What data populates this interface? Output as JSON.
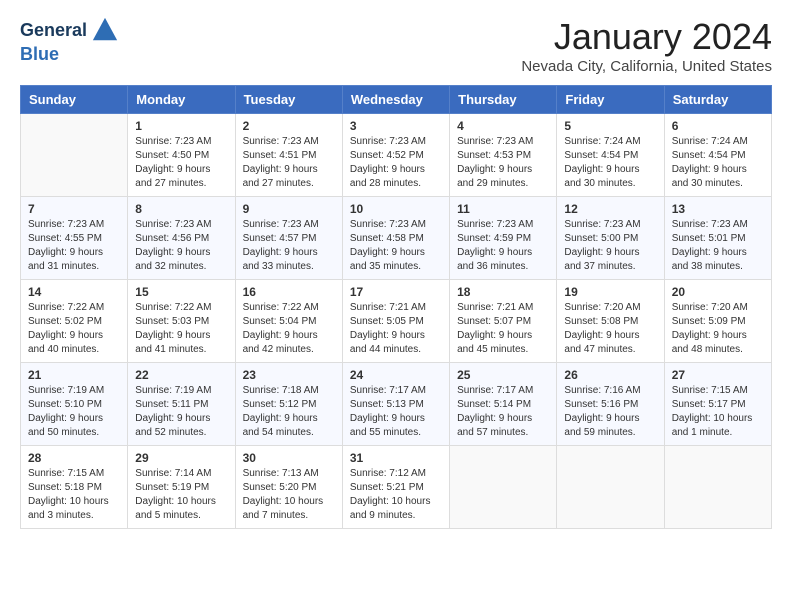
{
  "header": {
    "logo_general": "General",
    "logo_blue": "Blue",
    "month_title": "January 2024",
    "location": "Nevada City, California, United States"
  },
  "calendar": {
    "days_of_week": [
      "Sunday",
      "Monday",
      "Tuesday",
      "Wednesday",
      "Thursday",
      "Friday",
      "Saturday"
    ],
    "weeks": [
      [
        {
          "day": "",
          "info": ""
        },
        {
          "day": "1",
          "info": "Sunrise: 7:23 AM\nSunset: 4:50 PM\nDaylight: 9 hours\nand 27 minutes."
        },
        {
          "day": "2",
          "info": "Sunrise: 7:23 AM\nSunset: 4:51 PM\nDaylight: 9 hours\nand 27 minutes."
        },
        {
          "day": "3",
          "info": "Sunrise: 7:23 AM\nSunset: 4:52 PM\nDaylight: 9 hours\nand 28 minutes."
        },
        {
          "day": "4",
          "info": "Sunrise: 7:23 AM\nSunset: 4:53 PM\nDaylight: 9 hours\nand 29 minutes."
        },
        {
          "day": "5",
          "info": "Sunrise: 7:24 AM\nSunset: 4:54 PM\nDaylight: 9 hours\nand 30 minutes."
        },
        {
          "day": "6",
          "info": "Sunrise: 7:24 AM\nSunset: 4:54 PM\nDaylight: 9 hours\nand 30 minutes."
        }
      ],
      [
        {
          "day": "7",
          "info": "Sunrise: 7:23 AM\nSunset: 4:55 PM\nDaylight: 9 hours\nand 31 minutes."
        },
        {
          "day": "8",
          "info": "Sunrise: 7:23 AM\nSunset: 4:56 PM\nDaylight: 9 hours\nand 32 minutes."
        },
        {
          "day": "9",
          "info": "Sunrise: 7:23 AM\nSunset: 4:57 PM\nDaylight: 9 hours\nand 33 minutes."
        },
        {
          "day": "10",
          "info": "Sunrise: 7:23 AM\nSunset: 4:58 PM\nDaylight: 9 hours\nand 35 minutes."
        },
        {
          "day": "11",
          "info": "Sunrise: 7:23 AM\nSunset: 4:59 PM\nDaylight: 9 hours\nand 36 minutes."
        },
        {
          "day": "12",
          "info": "Sunrise: 7:23 AM\nSunset: 5:00 PM\nDaylight: 9 hours\nand 37 minutes."
        },
        {
          "day": "13",
          "info": "Sunrise: 7:23 AM\nSunset: 5:01 PM\nDaylight: 9 hours\nand 38 minutes."
        }
      ],
      [
        {
          "day": "14",
          "info": "Sunrise: 7:22 AM\nSunset: 5:02 PM\nDaylight: 9 hours\nand 40 minutes."
        },
        {
          "day": "15",
          "info": "Sunrise: 7:22 AM\nSunset: 5:03 PM\nDaylight: 9 hours\nand 41 minutes."
        },
        {
          "day": "16",
          "info": "Sunrise: 7:22 AM\nSunset: 5:04 PM\nDaylight: 9 hours\nand 42 minutes."
        },
        {
          "day": "17",
          "info": "Sunrise: 7:21 AM\nSunset: 5:05 PM\nDaylight: 9 hours\nand 44 minutes."
        },
        {
          "day": "18",
          "info": "Sunrise: 7:21 AM\nSunset: 5:07 PM\nDaylight: 9 hours\nand 45 minutes."
        },
        {
          "day": "19",
          "info": "Sunrise: 7:20 AM\nSunset: 5:08 PM\nDaylight: 9 hours\nand 47 minutes."
        },
        {
          "day": "20",
          "info": "Sunrise: 7:20 AM\nSunset: 5:09 PM\nDaylight: 9 hours\nand 48 minutes."
        }
      ],
      [
        {
          "day": "21",
          "info": "Sunrise: 7:19 AM\nSunset: 5:10 PM\nDaylight: 9 hours\nand 50 minutes."
        },
        {
          "day": "22",
          "info": "Sunrise: 7:19 AM\nSunset: 5:11 PM\nDaylight: 9 hours\nand 52 minutes."
        },
        {
          "day": "23",
          "info": "Sunrise: 7:18 AM\nSunset: 5:12 PM\nDaylight: 9 hours\nand 54 minutes."
        },
        {
          "day": "24",
          "info": "Sunrise: 7:17 AM\nSunset: 5:13 PM\nDaylight: 9 hours\nand 55 minutes."
        },
        {
          "day": "25",
          "info": "Sunrise: 7:17 AM\nSunset: 5:14 PM\nDaylight: 9 hours\nand 57 minutes."
        },
        {
          "day": "26",
          "info": "Sunrise: 7:16 AM\nSunset: 5:16 PM\nDaylight: 9 hours\nand 59 minutes."
        },
        {
          "day": "27",
          "info": "Sunrise: 7:15 AM\nSunset: 5:17 PM\nDaylight: 10 hours\nand 1 minute."
        }
      ],
      [
        {
          "day": "28",
          "info": "Sunrise: 7:15 AM\nSunset: 5:18 PM\nDaylight: 10 hours\nand 3 minutes."
        },
        {
          "day": "29",
          "info": "Sunrise: 7:14 AM\nSunset: 5:19 PM\nDaylight: 10 hours\nand 5 minutes."
        },
        {
          "day": "30",
          "info": "Sunrise: 7:13 AM\nSunset: 5:20 PM\nDaylight: 10 hours\nand 7 minutes."
        },
        {
          "day": "31",
          "info": "Sunrise: 7:12 AM\nSunset: 5:21 PM\nDaylight: 10 hours\nand 9 minutes."
        },
        {
          "day": "",
          "info": ""
        },
        {
          "day": "",
          "info": ""
        },
        {
          "day": "",
          "info": ""
        }
      ]
    ]
  }
}
